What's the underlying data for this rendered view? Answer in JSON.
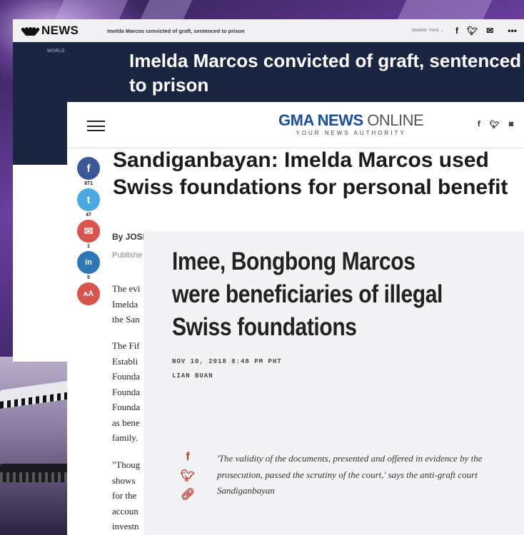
{
  "nbc": {
    "logo_text": "NEWS",
    "topbar_headline": "Imelda Marcos convicted of graft, sentenced to prison",
    "share_label": "SHARE THIS",
    "share_icons": [
      "facebook-icon",
      "twitter-icon",
      "mail-icon"
    ],
    "more_icon": "•••",
    "section": "WORLD",
    "title": "Imelda Marcos convicted of graft, sentenced to prison"
  },
  "gma": {
    "logo_main": "GMA NEWS",
    "logo_online": "ONLINE",
    "logo_tag": "YOUR NEWS AUTHORITY",
    "social_icons": [
      "facebook-icon",
      "twitter-icon",
      "instagram-icon"
    ],
    "title": "Sandiganbayan: Imelda Marcos used Swiss foundations for personal benefit",
    "byline": "By JOSE",
    "published": "Publishe",
    "share_buttons": [
      {
        "icon": "facebook-icon",
        "glyph": "f",
        "count": "871",
        "color": "#3b5998"
      },
      {
        "icon": "twitter-icon",
        "glyph": "t",
        "count": "47",
        "color": "#4aa8e0"
      },
      {
        "icon": "mail-icon",
        "glyph": "✉",
        "count": "1",
        "color": "#d9534f"
      },
      {
        "icon": "linkedin-icon",
        "glyph": "in",
        "count": "5",
        "color": "#2d77b5"
      },
      {
        "icon": "font-size-icon",
        "glyph": "ᴀA",
        "count": "",
        "color": "#d9534f"
      }
    ],
    "body_lines_p1": [
      "The evi",
      "Imelda",
      "the San"
    ],
    "body_lines_p2": [
      "The Fif",
      "Establi",
      "Founda",
      "Founda",
      "Founda",
      "as bene",
      "family."
    ],
    "body_lines_p3": [
      "\"Thoug",
      "shows",
      "for the",
      "accoun",
      "investn"
    ]
  },
  "rappler": {
    "title": "Imee, Bongbong Marcos were beneficiaries of illegal Swiss foundations",
    "date": "NOV 10, 2018 8:48 PM PHT",
    "author": "LIAN BUAN",
    "share_icons": [
      "facebook-icon",
      "twitter-icon",
      "link-icon"
    ],
    "quote": "'The validity of the documents, presented and offered in evidence by the prosecution, passed the scrutiny of the court,' says the anti-graft court Sandiganbayan"
  }
}
